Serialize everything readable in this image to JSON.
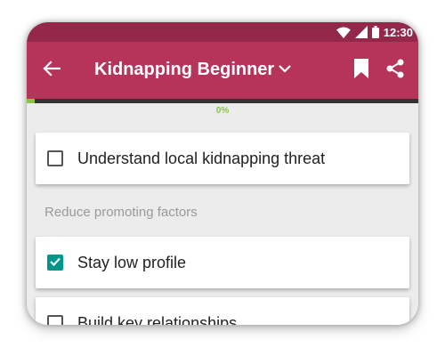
{
  "status_bar": {
    "time": "12:30"
  },
  "app_bar": {
    "title": "Kidnapping Beginner",
    "back_icon": "back-arrow-icon",
    "dropdown_icon": "chevron-down-icon",
    "bookmark_icon": "bookmark-icon",
    "share_icon": "share-icon"
  },
  "progress": {
    "value": 0.02,
    "label": "0%"
  },
  "checklist": [
    {
      "label": "Understand local kidnapping threat",
      "checked": false
    },
    {
      "section": "Reduce promoting factors"
    },
    {
      "label": "Stay low profile",
      "checked": true
    },
    {
      "label": "Build key relationships",
      "checked": false
    }
  ],
  "colors": {
    "status_bar": "#93284a",
    "app_bar": "#b63459",
    "progress_fill": "#8bc34a",
    "checkbox_checked": "#009688",
    "background": "#ececec"
  }
}
